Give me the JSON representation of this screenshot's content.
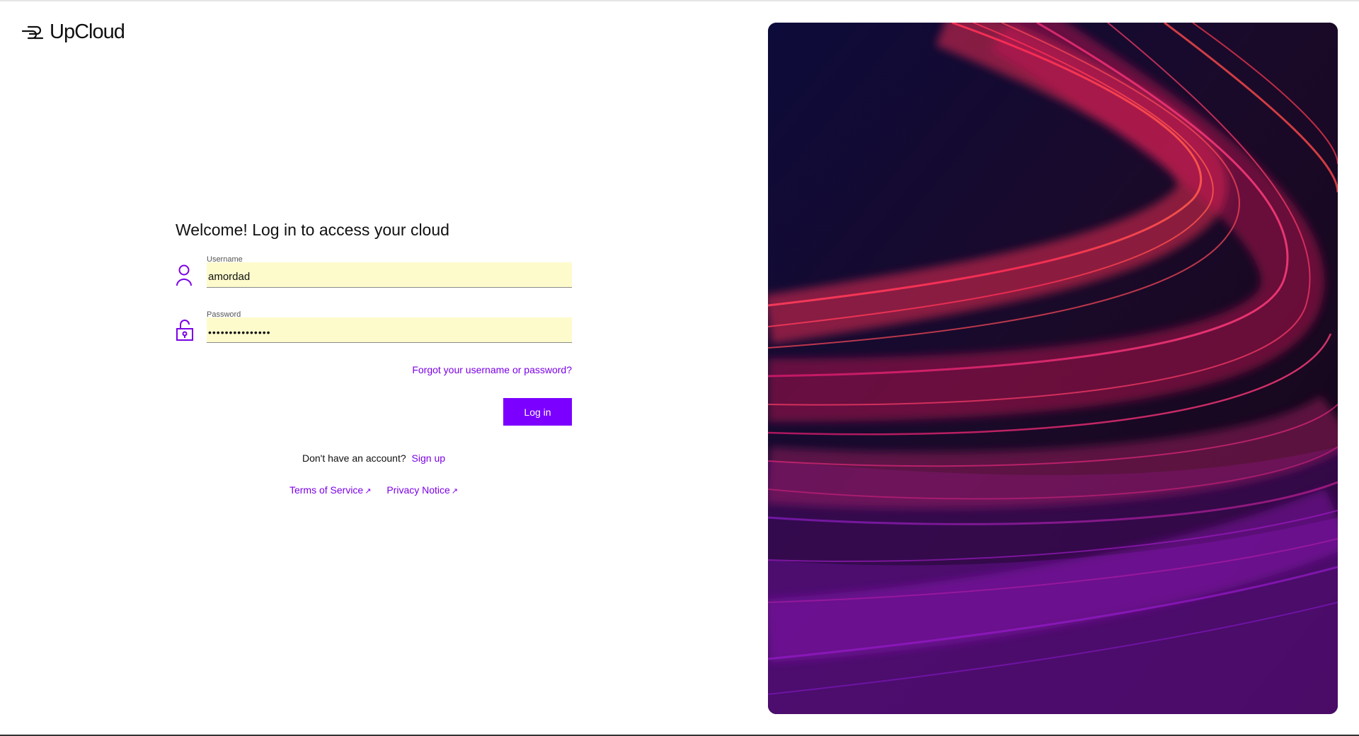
{
  "brand": {
    "name": "UpCloud",
    "accent_color": "#7b00ff",
    "logo_icon": "upcloud-logo-icon"
  },
  "login": {
    "title": "Welcome! Log in to access your cloud",
    "username": {
      "label": "Username",
      "value": "amordad",
      "icon": "user-icon"
    },
    "password": {
      "label": "Password",
      "value": "•••••••••••••••",
      "icon": "lock-icon"
    },
    "forgot_link": "Forgot your username or password?",
    "login_button": "Log in",
    "signup_prompt": "Don't have an account?",
    "signup_link": "Sign up",
    "terms_link": "Terms of Service",
    "privacy_link": "Privacy Notice",
    "external_icon": "external-link-icon"
  },
  "colors": {
    "input_background": "#fdfbcc",
    "link": "#7b00e6",
    "hero_background": "#120a2a"
  }
}
